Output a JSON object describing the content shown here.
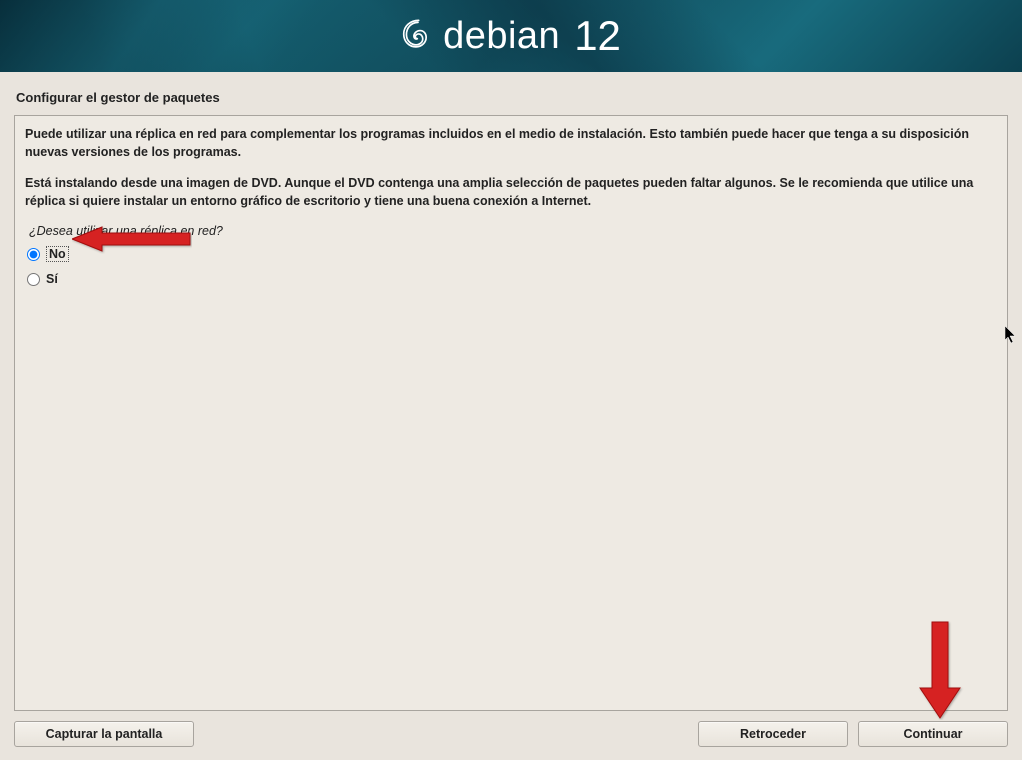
{
  "header": {
    "brand": "debian",
    "version": "12"
  },
  "section_title": "Configurar el gestor de paquetes",
  "description": {
    "para1": "Puede utilizar una réplica en red para complementar los programas incluidos en el medio de instalación. Esto también puede hacer que tenga a su disposición nuevas versiones de los programas.",
    "para2": "Está instalando desde una imagen de DVD. Aunque el DVD contenga una amplia selección de paquetes pueden faltar algunos. Se le recomienda que utilice una réplica si quiere instalar un entorno gráfico de escritorio y tiene una buena conexión a Internet."
  },
  "question": "¿Desea utilizar una réplica en red?",
  "options": {
    "no": "No",
    "yes": "Sí"
  },
  "buttons": {
    "screenshot": "Capturar la pantalla",
    "back": "Retroceder",
    "continue": "Continuar"
  }
}
